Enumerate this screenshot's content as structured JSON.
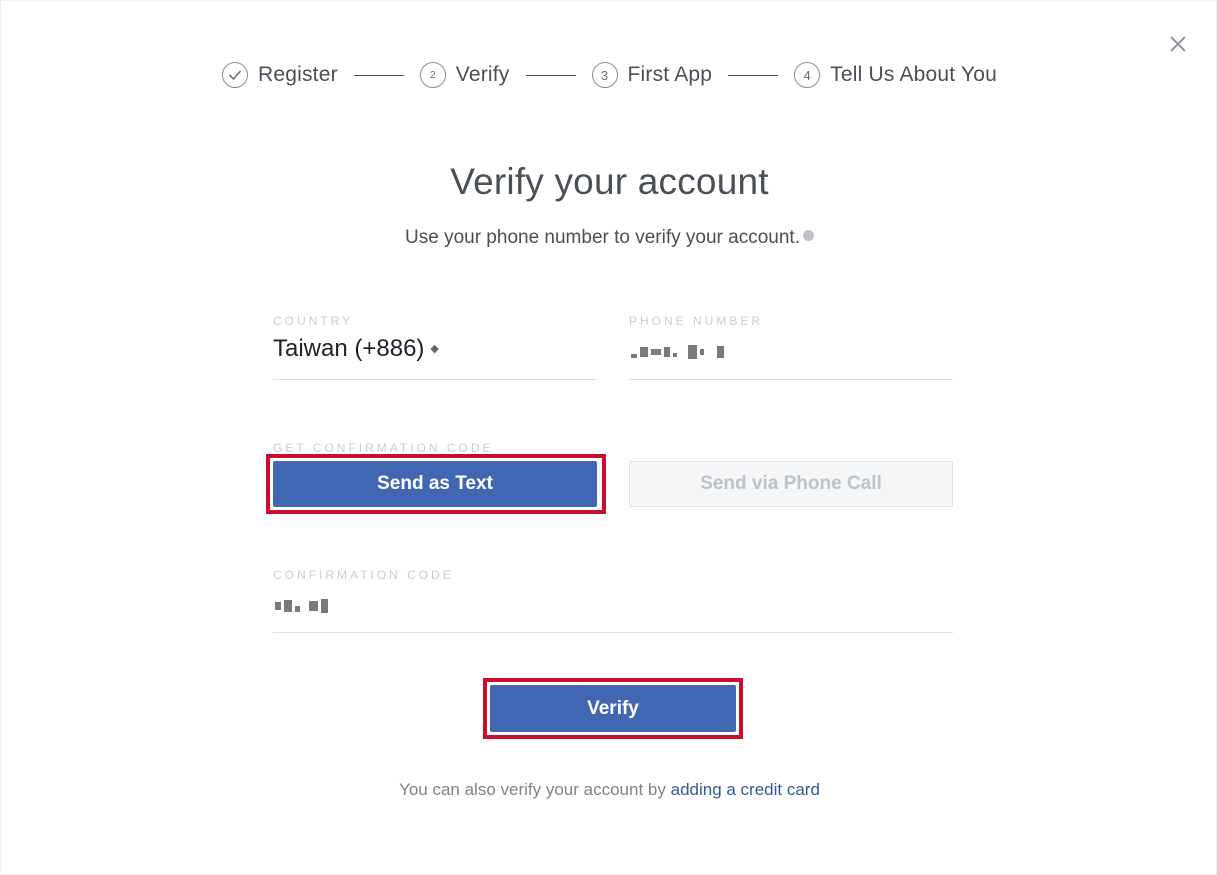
{
  "steps": [
    {
      "number": "",
      "label": "Register",
      "state": "completed"
    },
    {
      "number": "2",
      "label": "Verify",
      "state": "current"
    },
    {
      "number": "3",
      "label": "First App",
      "state": "upcoming"
    },
    {
      "number": "4",
      "label": "Tell Us About You",
      "state": "upcoming"
    }
  ],
  "header": {
    "title": "Verify your account",
    "subtitle": "Use your phone number to verify your account."
  },
  "form": {
    "country_label": "COUNTRY",
    "country_value": "Taiwan (+886)",
    "phone_label": "PHONE NUMBER",
    "get_code_label": "GET CONFIRMATION CODE",
    "send_text_button": "Send as Text",
    "send_call_button": "Send via Phone Call",
    "confirmation_label": "CONFIRMATION CODE",
    "verify_button": "Verify"
  },
  "footer": {
    "prefix": "You can also verify your account by",
    "link": "adding a credit card"
  },
  "colors": {
    "primary": "#4267b2",
    "highlight": "#c8102e",
    "link": "#365899"
  },
  "icons": {
    "close": "close-icon",
    "completed_step": "check-circle-icon",
    "info": "info-icon",
    "sort": "sort-arrows-icon"
  }
}
